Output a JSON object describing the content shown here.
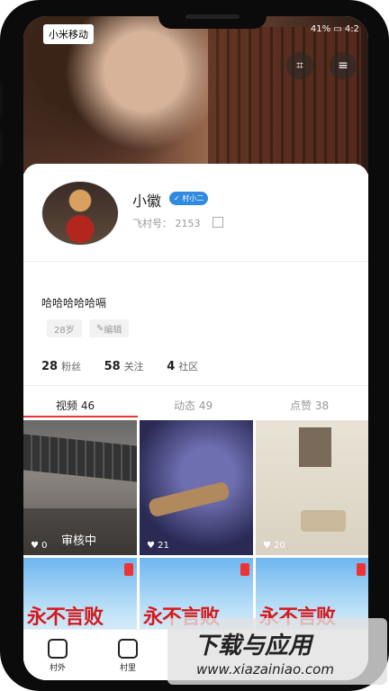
{
  "status_bar": {
    "carrier": "小米移动",
    "battery": "41%",
    "time": "4:2"
  },
  "profile": {
    "name": "小徽",
    "badge": "村小二",
    "id_label": "飞村号：",
    "id_value": "2153",
    "bio": "哈哈哈哈哈嗝",
    "age_chip": "28岁",
    "edit_chip": "编辑"
  },
  "stats": [
    {
      "value": "28",
      "label": "粉丝"
    },
    {
      "value": "58",
      "label": "关注"
    },
    {
      "value": "4",
      "label": "社区"
    }
  ],
  "tabs": [
    {
      "label": "视频 46"
    },
    {
      "label": "动态 49"
    },
    {
      "label": "点赞 38"
    }
  ],
  "videos": [
    {
      "likes": "0",
      "overlay": "审核中"
    },
    {
      "likes": "21"
    },
    {
      "likes": "20"
    }
  ],
  "banners": [
    {
      "text": "永不言败"
    },
    {
      "text": "永不言败"
    },
    {
      "text": "永不言败"
    }
  ],
  "bottom_nav": [
    {
      "label": "村外",
      "icon": "home-icon"
    },
    {
      "label": "村里",
      "icon": "village-icon"
    }
  ],
  "watermark": {
    "title": "下载与应用",
    "url": "www.xiazainiao.com"
  },
  "colors": {
    "accent": "#e33333",
    "badge_blue": "#2f8ae0"
  }
}
